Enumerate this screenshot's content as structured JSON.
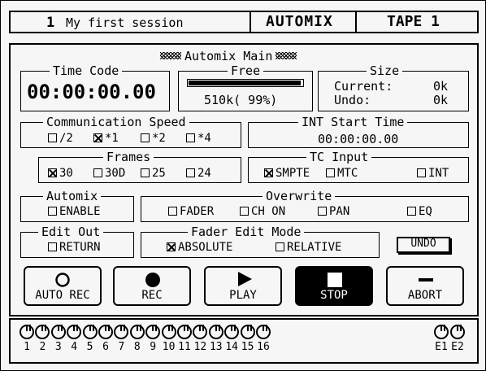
{
  "header": {
    "session_number": "1",
    "session_name": "My first session",
    "mode": "AUTOMIX",
    "tape": "TAPE 1"
  },
  "main_title": "Automix Main",
  "time_code": {
    "label": "Time Code",
    "value": "00:00:00.00"
  },
  "free": {
    "label": "Free",
    "value": "510k( 99%)",
    "fraction": 0.99
  },
  "size": {
    "label": "Size",
    "current_label": "Current:",
    "current_value": "0k",
    "undo_label": "Undo:",
    "undo_value": "0k"
  },
  "comm_speed": {
    "label": "Communication Speed",
    "options": [
      {
        "label": "/2",
        "checked": false
      },
      {
        "label": "*1",
        "checked": true
      },
      {
        "label": "*2",
        "checked": false
      },
      {
        "label": "*4",
        "checked": false
      }
    ]
  },
  "int_start": {
    "label": "INT Start Time",
    "value": "00:00:00.00"
  },
  "frames": {
    "label": "Frames",
    "options": [
      {
        "label": "30",
        "checked": true
      },
      {
        "label": "30D",
        "checked": false
      },
      {
        "label": "25",
        "checked": false
      },
      {
        "label": "24",
        "checked": false
      }
    ]
  },
  "tc_input": {
    "label": "TC Input",
    "options": [
      {
        "label": "SMPTE",
        "checked": true
      },
      {
        "label": "MTC",
        "checked": false
      },
      {
        "label": "INT",
        "checked": false
      }
    ]
  },
  "automix": {
    "label": "Automix",
    "enable_label": "ENABLE",
    "enable_checked": false
  },
  "overwrite": {
    "label": "Overwrite",
    "options": [
      {
        "label": "FADER",
        "checked": false
      },
      {
        "label": "CH ON",
        "checked": false
      },
      {
        "label": "PAN",
        "checked": false
      },
      {
        "label": "EQ",
        "checked": false
      }
    ]
  },
  "edit_out": {
    "label": "Edit Out",
    "return_label": "RETURN",
    "return_checked": false
  },
  "fader_edit": {
    "label": "Fader Edit Mode",
    "options": [
      {
        "label": "ABSOLUTE",
        "checked": true
      },
      {
        "label": "RELATIVE",
        "checked": false
      }
    ]
  },
  "undo_label": "UNDO",
  "transport": {
    "auto_rec": "AUTO REC",
    "rec": "REC",
    "play": "PLAY",
    "stop": "STOP",
    "abort": "ABORT"
  },
  "channels": [
    "1",
    "2",
    "3",
    "4",
    "5",
    "6",
    "7",
    "8",
    "9",
    "10",
    "11",
    "12",
    "13",
    "14",
    "15",
    "16"
  ],
  "extra_channels": [
    "E1",
    "E2"
  ],
  "colors": {
    "lcd_bg": "#f6f6f6",
    "ink": "#000000"
  }
}
